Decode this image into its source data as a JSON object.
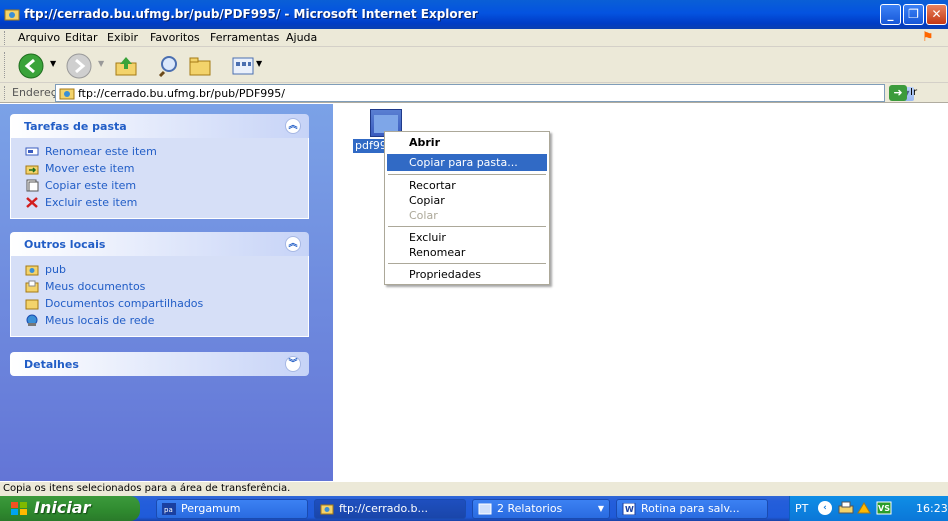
{
  "window": {
    "title": "ftp://cerrado.bu.ufmg.br/pub/PDF995/ - Microsoft Internet Explorer"
  },
  "menu": [
    "Arquivo",
    "Editar",
    "Exibir",
    "Favoritos",
    "Ferramentas",
    "Ajuda"
  ],
  "address": {
    "label": "Endereço",
    "value": "ftp://cerrado.bu.ufmg.br/pub/PDF995/",
    "go": "Ir"
  },
  "tasks_box": {
    "title": "Tarefas de pasta",
    "items": [
      "Renomear este item",
      "Mover este item",
      "Copiar este item",
      "Excluir este item"
    ]
  },
  "places_box": {
    "title": "Outros locais",
    "items": [
      "pub",
      "Meus documentos",
      "Documentos compartilhados",
      "Meus locais de rede"
    ]
  },
  "details_box": {
    "title": "Detalhes"
  },
  "file": {
    "label": "pdf99"
  },
  "context_menu": {
    "items": [
      "Abrir",
      "Copiar para pasta...",
      "Recortar",
      "Copiar",
      "Colar",
      "Excluir",
      "Renomear",
      "Propriedades"
    ],
    "selected": "Copiar para pasta...",
    "disabled": "Colar"
  },
  "status": "Copia os itens selecionados para a área de transferência.",
  "taskbar": {
    "start": "Iniciar",
    "tasks": [
      "Pergamum",
      "ftp://cerrado.b...",
      "2 Relatorios",
      "Rotina para salv..."
    ],
    "lang": "PT",
    "clock": "16:23"
  },
  "colors": {
    "title_blue": "#0453e0",
    "panel_blue": "#7ba2e7",
    "link_blue": "#215dc6",
    "select": "#316ac5",
    "start_green": "#3c9a3c"
  }
}
